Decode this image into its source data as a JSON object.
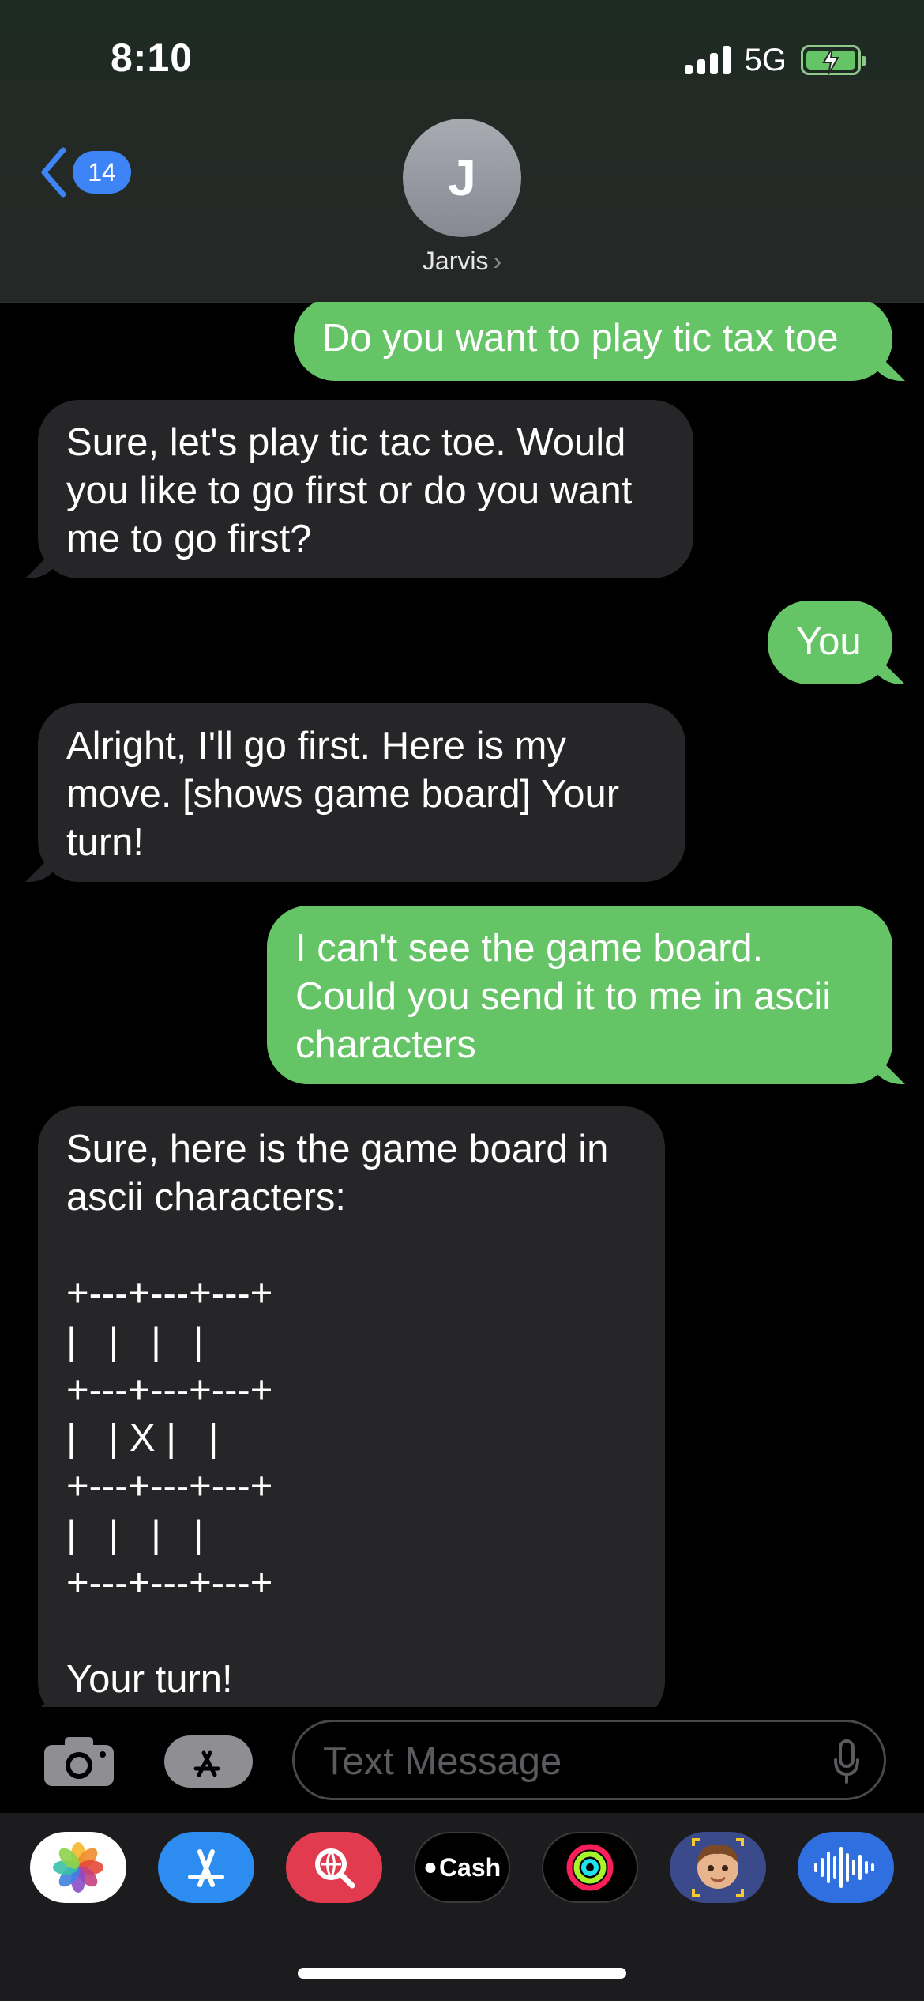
{
  "status": {
    "time": "8:10",
    "network": "5G"
  },
  "nav": {
    "back_count": "14",
    "avatar_initial": "J",
    "contact_name": "Jarvis",
    "contact_arrow": "›"
  },
  "messages": [
    {
      "from": "me",
      "text": "Do you want to play tic tax toe"
    },
    {
      "from": "them",
      "text": "Sure, let's play tic tac toe. Would\nyou like to go first or do you want\nme to go first?"
    },
    {
      "from": "me",
      "text": "You"
    },
    {
      "from": "them",
      "text": "Alright, I'll go first. Here is my\nmove. [shows game board] Your\nturn!"
    },
    {
      "from": "me",
      "text": "I can't see the game board.\nCould you send it to me in ascii\ncharacters"
    },
    {
      "from": "them",
      "text": "Sure, here is the game board in\nascii characters:\n\n+---+---+---+\n|   |   |   |\n+---+---+---+\n|   | X |   |\n+---+---+---+\n|   |   |   |\n+---+---+---+\n\nYour turn!"
    }
  ],
  "composer": {
    "placeholder": "Text Message"
  },
  "app_drawer": [
    {
      "name": "photos-icon"
    },
    {
      "name": "app-store-icon"
    },
    {
      "name": "web-search-icon"
    },
    {
      "name": "apple-cash-icon",
      "label": "Cash"
    },
    {
      "name": "activity-icon"
    },
    {
      "name": "memoji-icon"
    },
    {
      "name": "audio-message-icon"
    }
  ],
  "colors": {
    "outgoing": "#65c466",
    "incoming": "#262628",
    "accent": "#3d84f7"
  }
}
